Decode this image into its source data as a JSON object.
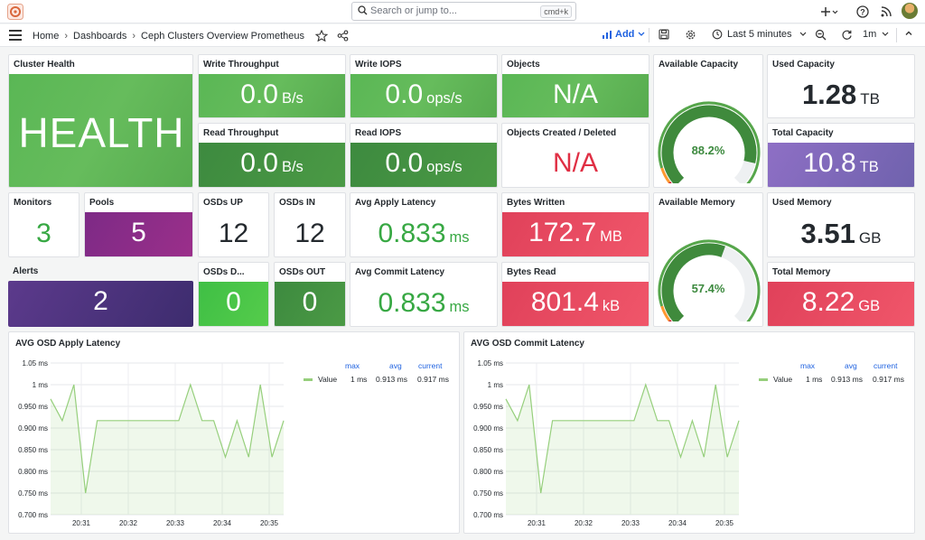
{
  "topbar": {
    "search_placeholder": "Search or jump to...",
    "search_shortcut": "cmd+k",
    "icons": [
      "grafana-logo-icon",
      "search-icon",
      "plus-icon",
      "help-icon",
      "rss-icon",
      "user-avatar"
    ]
  },
  "breadcrumb": {
    "home": "Home",
    "dashboards": "Dashboards",
    "current": "Ceph Clusters Overview Prometheus"
  },
  "toolbar": {
    "add_label": "Add",
    "time_range": "Last 5 minutes",
    "refresh_interval": "1m"
  },
  "panels": {
    "cluster_health": {
      "title": "Cluster Health",
      "value": "HEALTH"
    },
    "write_throughput": {
      "title": "Write Throughput",
      "value": "0.0",
      "unit": "B/s"
    },
    "read_throughput": {
      "title": "Read Throughput",
      "value": "0.0",
      "unit": "B/s"
    },
    "write_iops": {
      "title": "Write IOPS",
      "value": "0.0",
      "unit": "ops/s"
    },
    "read_iops": {
      "title": "Read IOPS",
      "value": "0.0",
      "unit": "ops/s"
    },
    "objects": {
      "title": "Objects",
      "value": "N/A"
    },
    "objects_created": {
      "title": "Objects Created / Deleted",
      "value": "N/A"
    },
    "available_capacity": {
      "title": "Available Capacity",
      "value": "88.2%",
      "fraction": 0.882
    },
    "used_capacity": {
      "title": "Used Capacity",
      "value": "1.28",
      "unit": "TB"
    },
    "total_capacity": {
      "title": "Total Capacity",
      "value": "10.8",
      "unit": "TB"
    },
    "monitors": {
      "title": "Monitors",
      "value": "3"
    },
    "pools": {
      "title": "Pools",
      "value": "5"
    },
    "osds_up": {
      "title": "OSDs UP",
      "value": "12"
    },
    "osds_in": {
      "title": "OSDs IN",
      "value": "12"
    },
    "avg_apply_latency": {
      "title": "Avg Apply Latency",
      "value": "0.833",
      "unit": "ms"
    },
    "bytes_written": {
      "title": "Bytes Written",
      "value": "172.7",
      "unit": "MB"
    },
    "available_memory": {
      "title": "Available Memory",
      "value": "57.4%",
      "fraction": 0.574
    },
    "used_memory": {
      "title": "Used Memory",
      "value": "3.51",
      "unit": "GB"
    },
    "alerts": {
      "title": "Alerts",
      "value": "2"
    },
    "osds_down": {
      "title": "OSDs D...",
      "value": "0"
    },
    "osds_out": {
      "title": "OSDs OUT",
      "value": "0"
    },
    "avg_commit_latency": {
      "title": "Avg Commit Latency",
      "value": "0.833",
      "unit": "ms"
    },
    "bytes_read": {
      "title": "Bytes Read",
      "value": "801.4",
      "unit": "kB"
    },
    "total_memory": {
      "title": "Total Memory",
      "value": "8.22",
      "unit": "GB"
    }
  },
  "colors": {
    "green": "#5ab755",
    "red_text": "#e02f44",
    "series": "#96cf7c",
    "link_blue": "#1f62e0"
  },
  "chart_data": [
    {
      "type": "line",
      "title": "AVG OSD Apply Latency",
      "x_ticks": [
        "20:31",
        "20:32",
        "20:33",
        "20:34",
        "20:35"
      ],
      "y_ticks": [
        "1.05 ms",
        "1 ms",
        "0.950 ms",
        "0.900 ms",
        "0.850 ms",
        "0.800 ms",
        "0.750 ms",
        "0.700 ms"
      ],
      "ylim": [
        0.7,
        1.05
      ],
      "series": [
        {
          "name": "Value",
          "values": [
            0.967,
            0.917,
            1.0,
            0.75,
            0.917,
            0.917,
            0.917,
            0.917,
            0.917,
            0.917,
            0.917,
            0.917,
            1.0,
            0.917,
            0.917,
            0.833,
            0.917,
            0.833,
            1.0,
            0.833,
            0.917
          ]
        }
      ],
      "legend": {
        "headers": [
          "max",
          "avg",
          "current"
        ],
        "max": "1 ms",
        "avg": "0.913 ms",
        "current": "0.917 ms"
      }
    },
    {
      "type": "line",
      "title": "AVG OSD Commit Latency",
      "x_ticks": [
        "20:31",
        "20:32",
        "20:33",
        "20:34",
        "20:35"
      ],
      "y_ticks": [
        "1.05 ms",
        "1 ms",
        "0.950 ms",
        "0.900 ms",
        "0.850 ms",
        "0.800 ms",
        "0.750 ms",
        "0.700 ms"
      ],
      "ylim": [
        0.7,
        1.05
      ],
      "series": [
        {
          "name": "Value",
          "values": [
            0.967,
            0.917,
            1.0,
            0.75,
            0.917,
            0.917,
            0.917,
            0.917,
            0.917,
            0.917,
            0.917,
            0.917,
            1.0,
            0.917,
            0.917,
            0.833,
            0.917,
            0.833,
            1.0,
            0.833,
            0.917
          ]
        }
      ],
      "legend": {
        "headers": [
          "max",
          "avg",
          "current"
        ],
        "max": "1 ms",
        "avg": "0.913 ms",
        "current": "0.917 ms"
      }
    }
  ]
}
